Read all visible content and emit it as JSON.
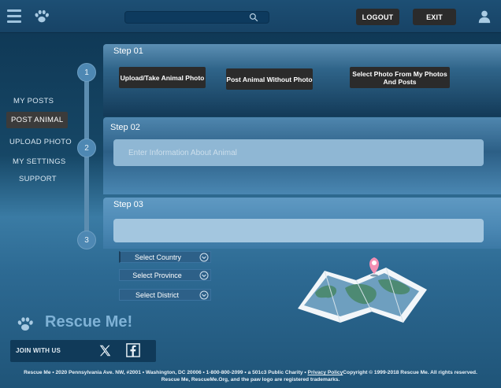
{
  "header": {
    "search": {
      "value": "",
      "placeholder": ""
    },
    "logout_label": "LOGOUT",
    "exit_label": "EXIT"
  },
  "sidebar": {
    "items": [
      {
        "label": "MY POSTS",
        "active": false
      },
      {
        "label": "POST ANIMAL",
        "active": true
      },
      {
        "label": "UPLOAD PHOTO",
        "active": false
      },
      {
        "label": "MY SETTINGS",
        "active": false
      },
      {
        "label": "SUPPORT",
        "active": false
      }
    ]
  },
  "steps": {
    "numbers": [
      "1",
      "2",
      "3"
    ],
    "step1": {
      "title": "Step 01",
      "buttons": [
        "Upload/Take Animal Photo",
        "Post Animal Without Photo",
        "Select Photo From My Photos And Posts"
      ]
    },
    "step2": {
      "title": "Step 02",
      "input": {
        "value": "",
        "placeholder": "Enter Information About Animal"
      }
    },
    "step3": {
      "title": "Step 03",
      "input": {
        "value": "",
        "placeholder": ""
      },
      "selects": [
        "Select Country",
        "Select Province",
        "Select District"
      ]
    }
  },
  "footer": {
    "brand": "Rescue Me!",
    "join_label": "JOIN WITH US",
    "line1_a": "Rescue Me • 2020 Pennsylvania Ave. NW, #2001 • Washington, DC 20006 • 1-800-800-2099 • a 501c3 Public Charity • ",
    "privacy_link": "Privacy Policy",
    "line1_b": "Copyright © 1999-2018 Rescue Me. All rights reserved.",
    "line2": "Rescue Me, RescueMe.Org, and the paw logo are registered trademarks."
  },
  "icons": {
    "menu": "hamburger-menu-icon",
    "logo": "paw-icon",
    "search": "search-icon",
    "user": "user-icon",
    "chevron": "chevron-down-icon",
    "map": "map-pin-icon",
    "x": "x-twitter-icon",
    "facebook": "facebook-icon"
  },
  "colors": {
    "accent_pin": "#f28fb3",
    "button_dark": "#2b2b2b",
    "brand_text": "#7fb2d6"
  }
}
